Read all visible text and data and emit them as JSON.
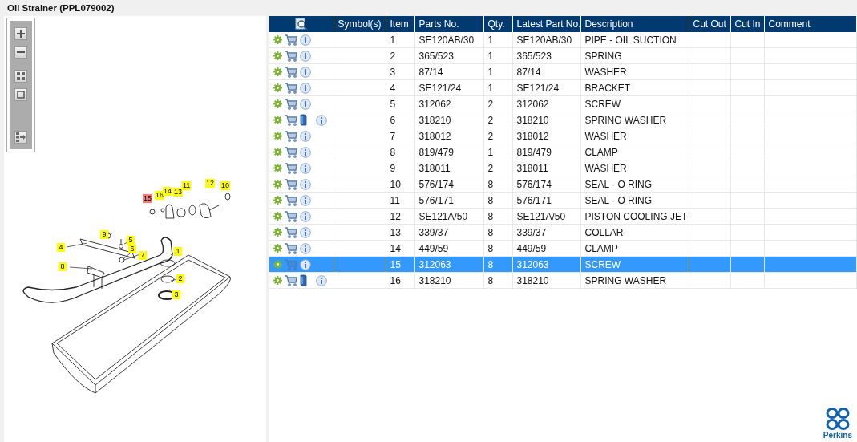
{
  "title": "Oil Strainer (PPL079002)",
  "diagram": {
    "callouts": [
      {
        "label": "15",
        "selected": true
      },
      {
        "label": "16",
        "selected": false
      },
      {
        "label": "14",
        "selected": false
      },
      {
        "label": "13",
        "selected": false
      },
      {
        "label": "11",
        "selected": false
      },
      {
        "label": "12",
        "selected": false
      },
      {
        "label": "10",
        "selected": false
      },
      {
        "label": "9",
        "selected": false
      },
      {
        "label": "4",
        "selected": false
      },
      {
        "label": "5",
        "selected": false
      },
      {
        "label": "6",
        "selected": false
      },
      {
        "label": "7",
        "selected": false
      },
      {
        "label": "1",
        "selected": false
      },
      {
        "label": "8",
        "selected": false
      },
      {
        "label": "2",
        "selected": false
      },
      {
        "label": "3",
        "selected": false
      }
    ]
  },
  "table": {
    "columns": [
      "Symbol(s)",
      "Item",
      "Parts No.",
      "Qty.",
      "Latest Part No.",
      "Description",
      "Cut Out",
      "Cut In",
      "Comment"
    ],
    "rows": [
      {
        "item": "1",
        "part_no": "SE120AB/30",
        "qty": "1",
        "latest_part_no": "SE120AB/30",
        "description": "PIPE - OIL SUCTION",
        "has_document": false,
        "selected": false
      },
      {
        "item": "2",
        "part_no": "365/523",
        "qty": "1",
        "latest_part_no": "365/523",
        "description": "SPRING",
        "has_document": false,
        "selected": false
      },
      {
        "item": "3",
        "part_no": "87/14",
        "qty": "1",
        "latest_part_no": "87/14",
        "description": "WASHER",
        "has_document": false,
        "selected": false
      },
      {
        "item": "4",
        "part_no": "SE121/24",
        "qty": "1",
        "latest_part_no": "SE121/24",
        "description": "BRACKET",
        "has_document": false,
        "selected": false
      },
      {
        "item": "5",
        "part_no": "312062",
        "qty": "2",
        "latest_part_no": "312062",
        "description": "SCREW",
        "has_document": false,
        "selected": false
      },
      {
        "item": "6",
        "part_no": "318210",
        "qty": "2",
        "latest_part_no": "318210",
        "description": "SPRING WASHER",
        "has_document": true,
        "selected": false
      },
      {
        "item": "7",
        "part_no": "318012",
        "qty": "2",
        "latest_part_no": "318012",
        "description": "WASHER",
        "has_document": false,
        "selected": false
      },
      {
        "item": "8",
        "part_no": "819/479",
        "qty": "1",
        "latest_part_no": "819/479",
        "description": "CLAMP",
        "has_document": false,
        "selected": false
      },
      {
        "item": "9",
        "part_no": "318011",
        "qty": "2",
        "latest_part_no": "318011",
        "description": "WASHER",
        "has_document": false,
        "selected": false
      },
      {
        "item": "10",
        "part_no": "576/174",
        "qty": "8",
        "latest_part_no": "576/174",
        "description": "SEAL - O RING",
        "has_document": false,
        "selected": false
      },
      {
        "item": "11",
        "part_no": "576/171",
        "qty": "8",
        "latest_part_no": "576/171",
        "description": "SEAL - O RING",
        "has_document": false,
        "selected": false
      },
      {
        "item": "12",
        "part_no": "SE121A/50",
        "qty": "8",
        "latest_part_no": "SE121A/50",
        "description": "PISTON COOLING JET",
        "has_document": false,
        "selected": false
      },
      {
        "item": "13",
        "part_no": "339/37",
        "qty": "8",
        "latest_part_no": "339/37",
        "description": "COLLAR",
        "has_document": false,
        "selected": false
      },
      {
        "item": "14",
        "part_no": "449/59",
        "qty": "8",
        "latest_part_no": "449/59",
        "description": "CLAMP",
        "has_document": false,
        "selected": false
      },
      {
        "item": "15",
        "part_no": "312063",
        "qty": "8",
        "latest_part_no": "312063",
        "description": "SCREW",
        "has_document": false,
        "selected": true
      },
      {
        "item": "16",
        "part_no": "318210",
        "qty": "8",
        "latest_part_no": "318210",
        "description": "SPRING WASHER",
        "has_document": true,
        "selected": false
      }
    ]
  },
  "logo": {
    "text": "Perkins"
  }
}
